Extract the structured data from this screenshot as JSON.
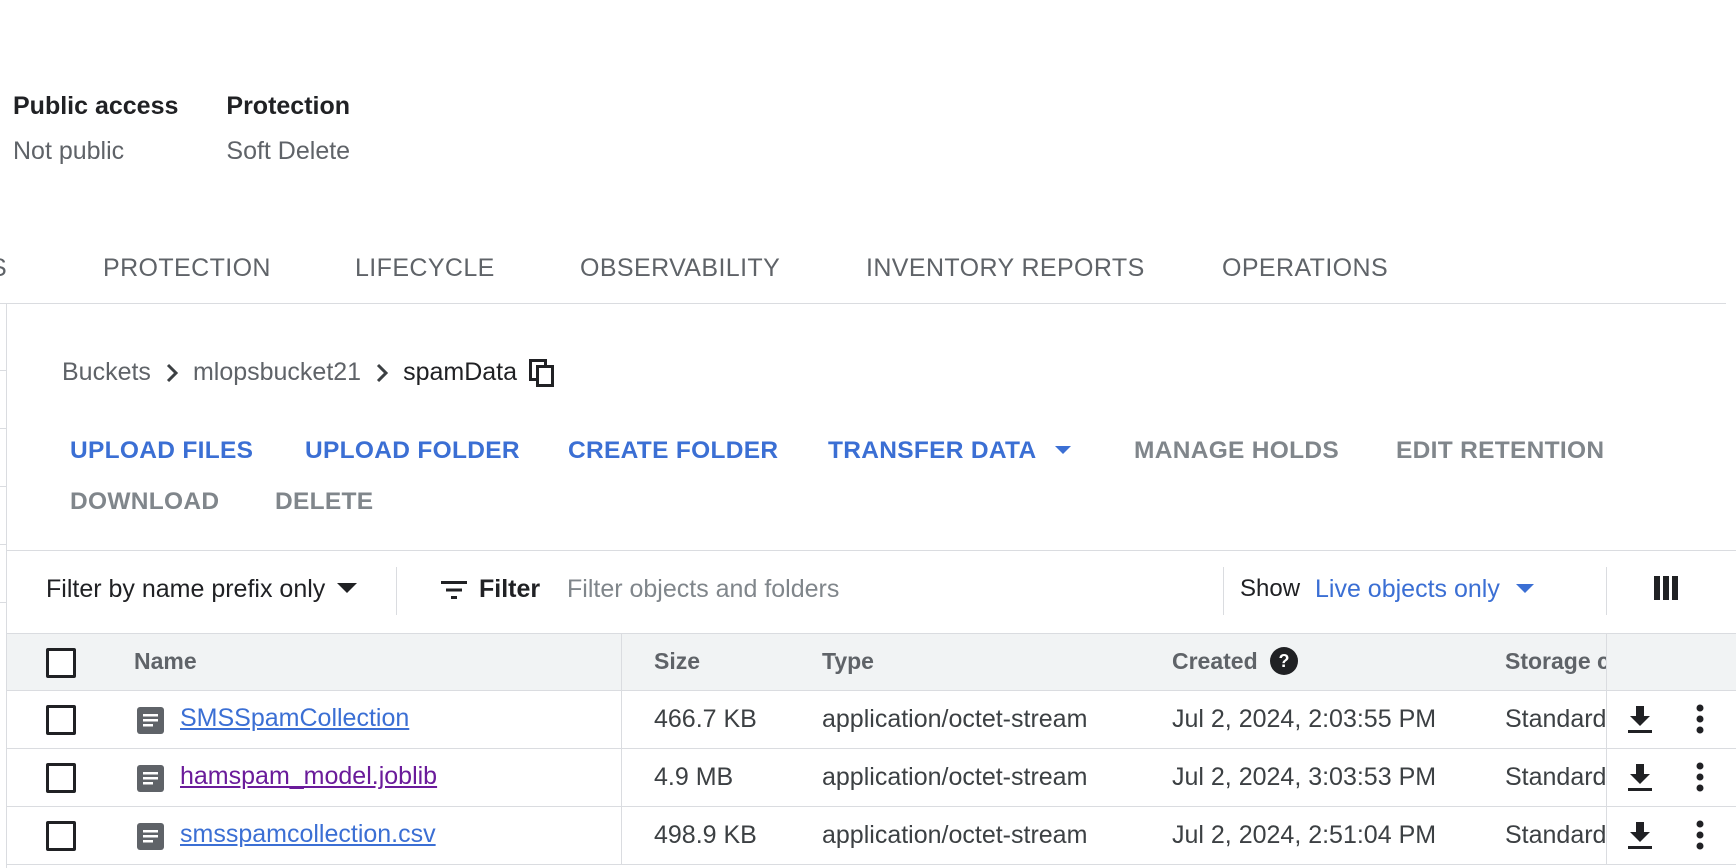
{
  "summary": {
    "public_access_label": "Public access",
    "public_access_value": "Not public",
    "protection_label": "Protection",
    "protection_value": "Soft Delete"
  },
  "tabs": {
    "partial": "S",
    "protection": "PROTECTION",
    "lifecycle": "LIFECYCLE",
    "observability": "OBSERVABILITY",
    "inventory_reports": "INVENTORY REPORTS",
    "operations": "OPERATIONS"
  },
  "breadcrumb": {
    "root": "Buckets",
    "bucket": "mlopsbucket21",
    "folder": "spamData"
  },
  "actions": {
    "upload_files": "UPLOAD FILES",
    "upload_folder": "UPLOAD FOLDER",
    "create_folder": "CREATE FOLDER",
    "transfer_data": "TRANSFER DATA",
    "manage_holds": "MANAGE HOLDS",
    "edit_retention": "EDIT RETENTION",
    "download": "DOWNLOAD",
    "delete": "DELETE"
  },
  "filterbar": {
    "prefix_select": "Filter by name prefix only",
    "filter_label": "Filter",
    "filter_placeholder": "Filter objects and folders",
    "show_label": "Show",
    "show_value": "Live objects only"
  },
  "table": {
    "headers": {
      "name": "Name",
      "size": "Size",
      "type": "Type",
      "created": "Created",
      "storage_class": "Storage c"
    },
    "rows": [
      {
        "name": "SMSSpamCollection",
        "size": "466.7 KB",
        "type": "application/octet-stream",
        "created": "Jul 2, 2024, 2:03:55 PM",
        "storage": "Standard",
        "visited": false
      },
      {
        "name": "hamspam_model.joblib",
        "size": "4.9 MB",
        "type": "application/octet-stream",
        "created": "Jul 2, 2024, 3:03:53 PM",
        "storage": "Standard",
        "visited": true
      },
      {
        "name": "smsspamcollection.csv",
        "size": "498.9 KB",
        "type": "application/octet-stream",
        "created": "Jul 2, 2024, 2:51:04 PM",
        "storage": "Standard",
        "visited": false
      }
    ]
  },
  "colors": {
    "link": "#3b6fd4",
    "visited_link": "#6a1b9a",
    "disabled": "#80868b",
    "border": "#dadce0",
    "header_bg": "#f1f3f4"
  },
  "icons": {
    "breadcrumb_separator": "chevron-right-icon",
    "copy": "copy-icon",
    "filter": "filter-lines-icon",
    "columns": "column-display-icon",
    "help": "help-circle-icon",
    "file": "file-document-icon",
    "download": "download-icon",
    "more": "more-vert-icon"
  }
}
